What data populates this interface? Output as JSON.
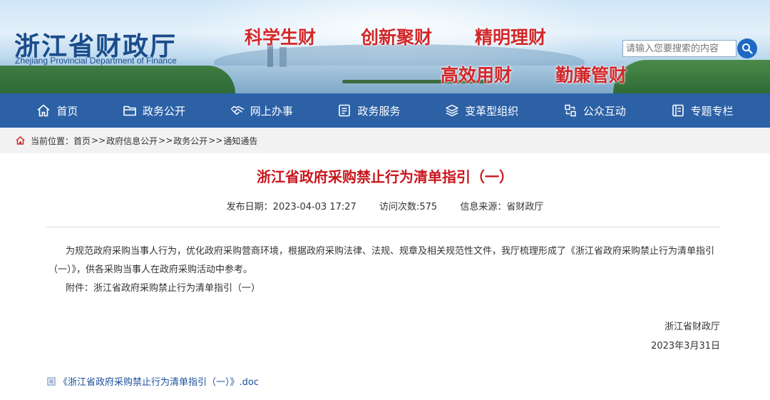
{
  "header": {
    "logo_cn": "浙江省财政厅",
    "logo_en": "Zhejiang Provincial Department of Finance",
    "slogans": [
      "科学生财",
      "创新聚财",
      "精明理财",
      "高效用财",
      "勤廉管财"
    ],
    "search": {
      "placeholder": "请输入您要搜索的内容"
    }
  },
  "nav": {
    "items": [
      {
        "label": "首页",
        "icon": "home-icon"
      },
      {
        "label": "政务公开",
        "icon": "folder-icon"
      },
      {
        "label": "网上办事",
        "icon": "handshake-icon"
      },
      {
        "label": "政务服务",
        "icon": "document-icon"
      },
      {
        "label": "变革型组织",
        "icon": "layers-icon"
      },
      {
        "label": "公众互动",
        "icon": "interaction-icon"
      },
      {
        "label": "专题专栏",
        "icon": "column-icon"
      }
    ]
  },
  "breadcrumb": {
    "prefix": "当前位置：",
    "items": [
      "首页",
      "政府信息公开",
      "政务公开",
      "通知通告"
    ],
    "separator": ">>"
  },
  "article": {
    "title": "浙江省政府采购禁止行为清单指引（一）",
    "publish_date": "发布日期：2023-04-03 17:27",
    "visits": "访问次数:575",
    "source": "信息来源：省财政厅",
    "paragraph1": "为规范政府采购当事人行为，优化政府采购营商环境，根据政府采购法律、法规、规章及相关规范性文件，我厅梳理形成了《浙江省政府采购禁止行为清单指引（一）》，供各采购当事人在政府采购活动中参考。",
    "attachment_line": "附件：浙江省政府采购禁止行为清单指引（一）",
    "signature_org": "浙江省财政厅",
    "signature_date": "2023年3月31日",
    "attachment_file": "《浙江省政府采购禁止行为清单指引（一）》.doc"
  },
  "colors": {
    "nav_bg": "#2c61a6",
    "title_red": "#c8161d",
    "logo_blue": "#1b4d8c",
    "slogan_red": "#d1282b",
    "link_blue": "#1a4f9c"
  }
}
